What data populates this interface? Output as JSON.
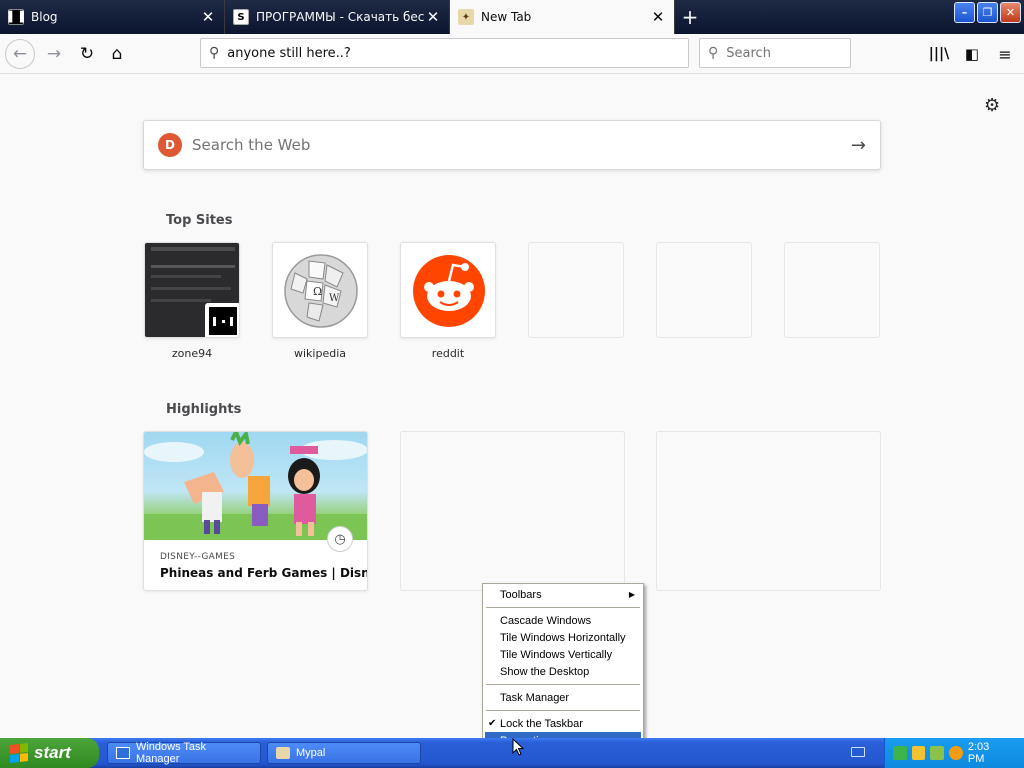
{
  "tabs": [
    {
      "title": "Blog",
      "favicon": "blog-favicon",
      "active": false
    },
    {
      "title": "ПРОГРАММЫ - Скачать бесплатно",
      "favicon": "s-favicon",
      "active": false
    },
    {
      "title": "New Tab",
      "favicon": "mypal-favicon",
      "active": true
    }
  ],
  "url_bar": {
    "value": "anyone still here..?"
  },
  "search_bar": {
    "placeholder": "Search"
  },
  "web_search": {
    "placeholder": "Search the Web"
  },
  "top_sites": {
    "title": "Top Sites",
    "items": [
      {
        "label": "zone94"
      },
      {
        "label": "wikipedia"
      },
      {
        "label": "reddit"
      },
      {
        "label": ""
      },
      {
        "label": ""
      },
      {
        "label": ""
      }
    ]
  },
  "highlights": {
    "title": "Highlights",
    "items": [
      {
        "host": "DISNEY--GAMES",
        "title": "Phineas and Ferb Games | Disney..."
      }
    ]
  },
  "context_menu": {
    "items": [
      {
        "label": "Toolbars",
        "submenu": true
      },
      {
        "label": "Cascade Windows"
      },
      {
        "label": "Tile Windows Horizontally"
      },
      {
        "label": "Tile Windows Vertically"
      },
      {
        "label": "Show the Desktop"
      },
      {
        "label": "Task Manager"
      },
      {
        "label": "Lock the Taskbar",
        "checked": true
      },
      {
        "label": "Properties",
        "selected": true
      }
    ]
  },
  "taskbar": {
    "start_label": "start",
    "tasks": [
      {
        "label": "Windows Task Manager",
        "icon": "task-manager-icon"
      },
      {
        "label": "Mypal",
        "icon": "mypal-icon"
      }
    ],
    "clock": "2:03 PM"
  },
  "colors": {
    "accent_start": "#2f8a21",
    "taskbar": "#2457d0",
    "reddit": "#ff4500",
    "duckduckgo": "#de5833",
    "menu_selected": "#316ac5"
  }
}
